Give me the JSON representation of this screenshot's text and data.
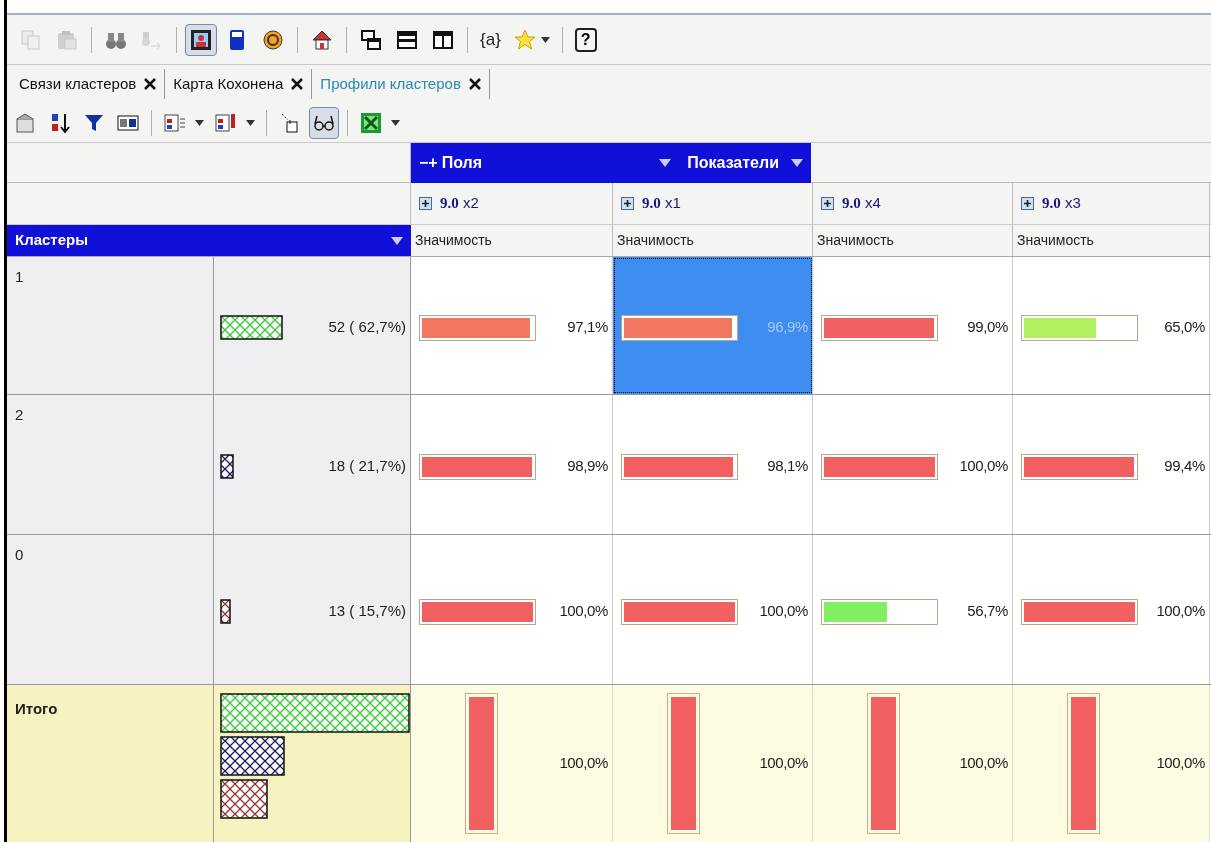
{
  "toolbar": {
    "groups": [
      [
        {
          "disabled": true,
          "pressed": false,
          "dropdown": false
        },
        {
          "disabled": true,
          "pressed": false,
          "dropdown": false
        }
      ],
      [
        {
          "disabled": false,
          "pressed": false,
          "dropdown": false
        },
        {
          "disabled": true,
          "pressed": false,
          "dropdown": false
        }
      ],
      [
        {
          "disabled": false,
          "pressed": true,
          "dropdown": false
        },
        {
          "disabled": false,
          "pressed": false,
          "dropdown": false
        },
        {
          "disabled": false,
          "pressed": false,
          "dropdown": false
        }
      ],
      [
        {
          "disabled": false,
          "pressed": false,
          "dropdown": false
        }
      ],
      [
        {
          "disabled": false,
          "pressed": false,
          "dropdown": false
        },
        {
          "disabled": false,
          "pressed": false,
          "dropdown": false
        },
        {
          "disabled": false,
          "pressed": false,
          "dropdown": false
        }
      ],
      [
        {
          "disabled": false,
          "pressed": false,
          "dropdown": false,
          "label": "{a}"
        },
        {
          "disabled": false,
          "pressed": false,
          "dropdown": true
        }
      ],
      [
        {
          "disabled": false,
          "pressed": false,
          "dropdown": false,
          "label": "?"
        }
      ]
    ]
  },
  "tabs": [
    {
      "label": "Связи кластеров",
      "selected": false
    },
    {
      "label": "Карта Кохонена",
      "selected": false
    },
    {
      "label": "Профили кластеров",
      "selected": true
    }
  ],
  "toolbar2": {
    "groups": [
      [
        {
          "pressed": false,
          "dropdown": false
        },
        {
          "pressed": false,
          "dropdown": false
        },
        {
          "pressed": false,
          "dropdown": false
        },
        {
          "pressed": false,
          "dropdown": false
        }
      ],
      [
        {
          "pressed": false,
          "dropdown": true
        },
        {
          "pressed": false,
          "dropdown": true
        }
      ],
      [
        {
          "pressed": false,
          "dropdown": false
        },
        {
          "pressed": true,
          "dropdown": false
        }
      ],
      [
        {
          "pressed": false,
          "dropdown": true
        }
      ]
    ]
  },
  "fields_bar": {
    "toggle": "−+",
    "fields": "Поля",
    "measures": "Показатели"
  },
  "columns": [
    {
      "title": "**9.0** x2",
      "measure": "Значимость"
    },
    {
      "title": "**9.0** x1",
      "measure": "Значимость"
    },
    {
      "title": "**9.0** x4",
      "measure": "Значимость"
    },
    {
      "title": "**9.0** x3",
      "measure": "Значимость"
    }
  ],
  "row_header": "Кластеры",
  "rows": [
    {
      "cluster": "1",
      "count": "52 ( 62,7%)",
      "cells": [
        {
          "value": "97,1%",
          "level": 0.971,
          "color": "#f07860",
          "selected": false
        },
        {
          "value": "96,9%",
          "level": 0.969,
          "color": "#f07860",
          "selected": true
        },
        {
          "value": "99,0%",
          "level": 0.99,
          "color": "#f06060",
          "selected": false
        },
        {
          "value": "65,0%",
          "level": 0.65,
          "color": "#b0f060",
          "selected": false
        }
      ]
    },
    {
      "cluster": "2",
      "count": "18 ( 21,7%)",
      "cells": [
        {
          "value": "98,9%",
          "level": 0.989,
          "color": "#f06060",
          "selected": false
        },
        {
          "value": "98,1%",
          "level": 0.981,
          "color": "#f06060",
          "selected": false
        },
        {
          "value": "100,0%",
          "level": 1.0,
          "color": "#f06060",
          "selected": false
        },
        {
          "value": "99,4%",
          "level": 0.994,
          "color": "#f06060",
          "selected": false
        }
      ]
    },
    {
      "cluster": "0",
      "count": "13 ( 15,7%)",
      "cells": [
        {
          "value": "100,0%",
          "level": 1.0,
          "color": "#f06060",
          "selected": false
        },
        {
          "value": "100,0%",
          "level": 1.0,
          "color": "#f06060",
          "selected": false
        },
        {
          "value": "56,7%",
          "level": 0.567,
          "color": "#80f060",
          "selected": false
        },
        {
          "value": "100,0%",
          "level": 1.0,
          "color": "#f06060",
          "selected": false
        }
      ]
    }
  ],
  "total": {
    "label": "Итого",
    "cells": [
      {
        "value": "100,0%",
        "level": 1.0,
        "color": "#f06060"
      },
      {
        "value": "100,0%",
        "level": 1.0,
        "color": "#f06060"
      },
      {
        "value": "100,0%",
        "level": 1.0,
        "color": "#f06060"
      },
      {
        "value": "100,0%",
        "level": 1.0,
        "color": "#f06060"
      }
    ]
  }
}
